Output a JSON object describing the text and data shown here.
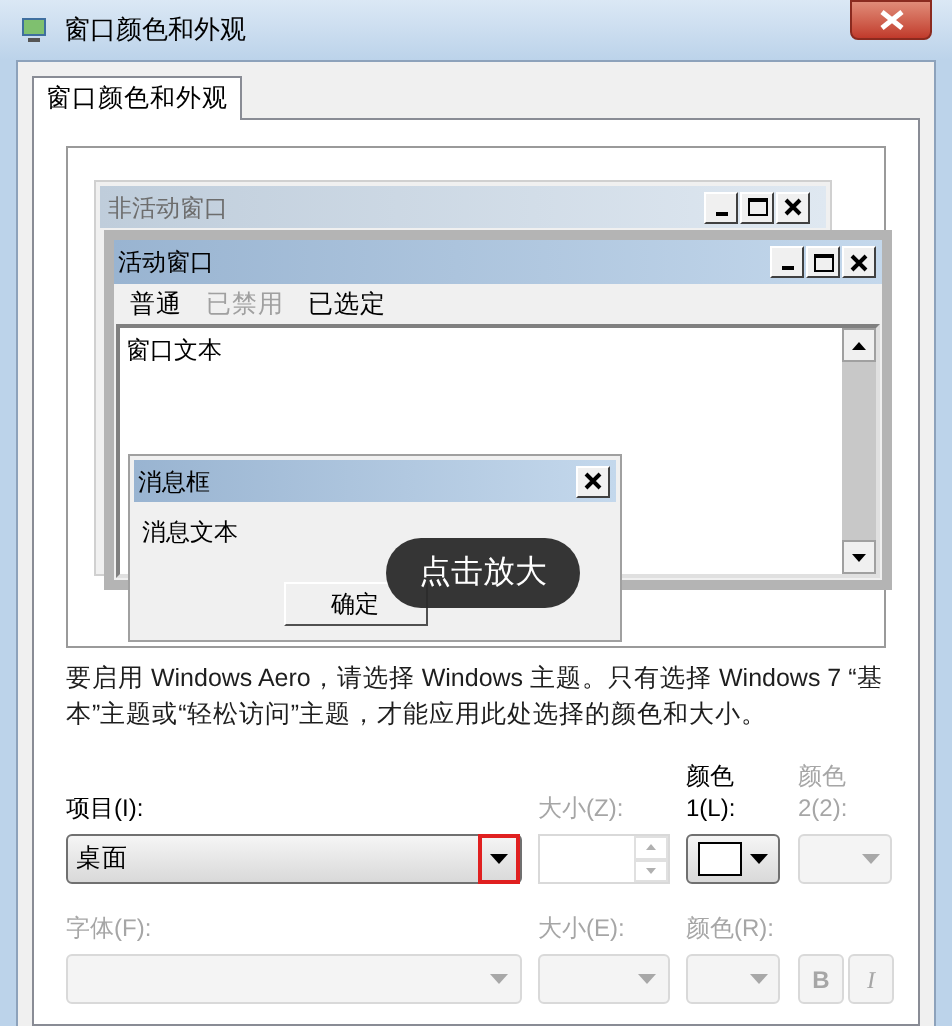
{
  "window": {
    "title": "窗口颜色和外观"
  },
  "tabs": [
    {
      "label": "窗口颜色和外观",
      "selected": true
    }
  ],
  "preview": {
    "inactive_window": {
      "title": "非活动窗口"
    },
    "active_window": {
      "title": "活动窗口",
      "menu": [
        {
          "label": "普通",
          "disabled": false
        },
        {
          "label": "已禁用",
          "disabled": true
        },
        {
          "label": "已选定",
          "disabled": false
        }
      ],
      "text": "窗口文本"
    },
    "message_box": {
      "title": "消息框",
      "text": "消息文本",
      "button": "确定"
    }
  },
  "zoom_hint": "点击放大",
  "description": "要启用 Windows Aero，请选择 Windows 主题。只有选择 Windows 7 “基本”主题或“轻松访问”主题，才能应用此处选择的颜色和大小。",
  "item_row": [
    {
      "kind": "combo",
      "label": "项目(I):",
      "value": "桌面",
      "disabled": false,
      "highlighted": true
    },
    {
      "kind": "spinner",
      "label": "大小(Z):",
      "disabled": true
    },
    {
      "kind": "color",
      "label": "颜色 1(L):",
      "disabled": false
    },
    {
      "kind": "color",
      "label": "颜色 2(2):",
      "disabled": true
    }
  ],
  "font_row": [
    {
      "kind": "combo",
      "label": "字体(F):",
      "disabled": true,
      "highlighted": false
    },
    {
      "kind": "combo",
      "label": "大小(E):",
      "disabled": true,
      "highlighted": false
    },
    {
      "kind": "color",
      "label": "颜色(R):",
      "disabled": true
    },
    {
      "kind": "toggle",
      "label": "B",
      "disabled": true
    },
    {
      "kind": "toggle",
      "label": "I",
      "disabled": true
    }
  ]
}
